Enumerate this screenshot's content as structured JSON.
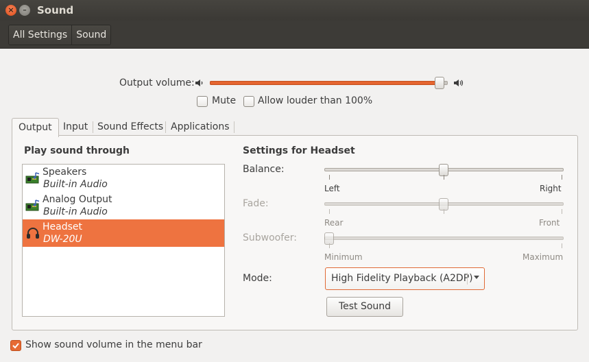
{
  "window": {
    "title": "Sound"
  },
  "toolbar": {
    "breadcrumbs": [
      "All Settings",
      "Sound"
    ]
  },
  "output_volume": {
    "label": "Output volume:",
    "level": 0.99
  },
  "options": {
    "mute": "Mute",
    "allow_louder": "Allow louder than 100%"
  },
  "tabs": [
    "Output",
    "Input",
    "Sound Effects",
    "Applications"
  ],
  "devices": {
    "heading": "Play sound through",
    "items": [
      {
        "name": "Speakers",
        "sub": "Built-in Audio"
      },
      {
        "name": "Analog Output",
        "sub": "Built-in Audio"
      },
      {
        "name": "Headset",
        "sub": "DW-20U",
        "selected": true
      }
    ]
  },
  "settings": {
    "heading": "Settings for Headset",
    "balance": {
      "label": "Balance:",
      "left": "Left",
      "right": "Right",
      "value": 0.5
    },
    "fade": {
      "label": "Fade:",
      "left": "Rear",
      "right": "Front",
      "value": 0.5
    },
    "subwoofer": {
      "label": "Subwoofer:",
      "left": "Minimum",
      "right": "Maximum",
      "value": 0.0
    },
    "mode": {
      "label": "Mode:",
      "value": "High Fidelity Playback (A2DP)"
    },
    "test_button": "Test Sound"
  },
  "footer": {
    "show_in_menu_bar": "Show sound volume in the menu bar",
    "checked": true
  },
  "colors": {
    "accent": "#ee7340",
    "titlebar": "#3d3b37"
  }
}
